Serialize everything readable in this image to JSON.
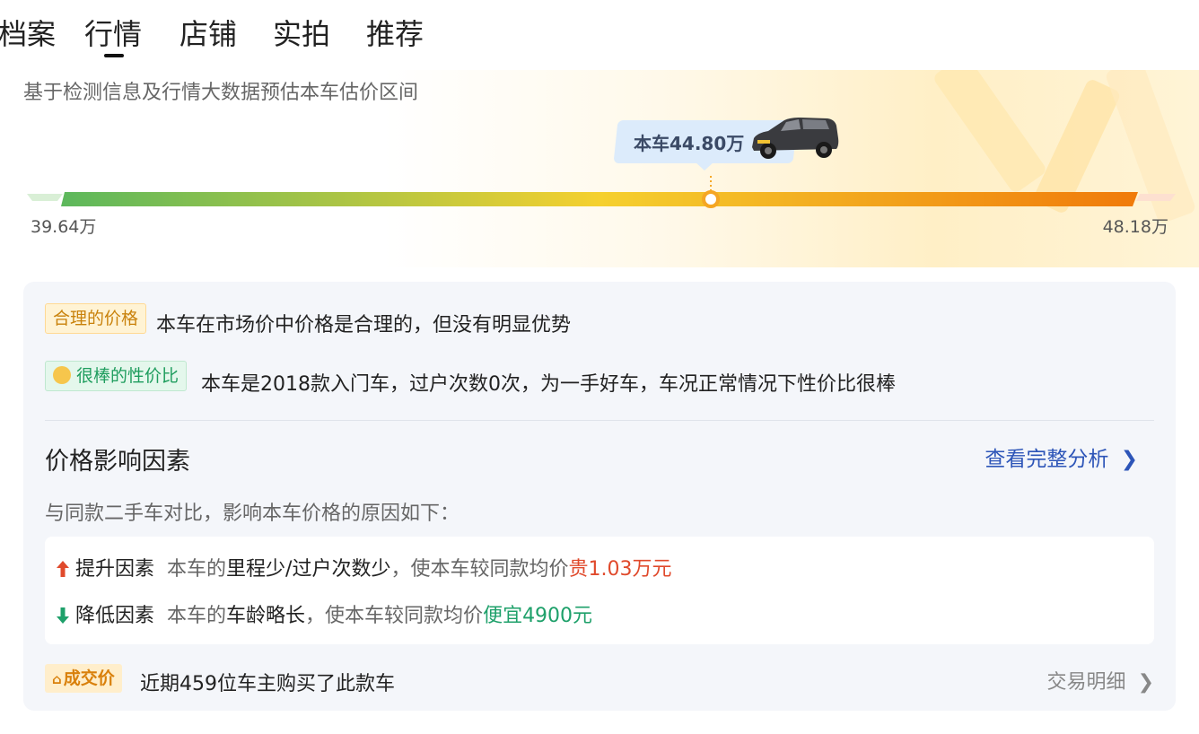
{
  "tabs": [
    "档案",
    "行情",
    "店铺",
    "实拍",
    "推荐"
  ],
  "active_tab": "行情",
  "estimate": {
    "subtitle": "基于检测信息及行情大数据预估本车估价区间",
    "current_price_label": "本车44.80万",
    "min_label": "39.64万",
    "max_label": "48.18万",
    "min_value": 39.64,
    "max_value": 48.18,
    "current_value": 44.8,
    "colors": {
      "green": "#5cb85c",
      "yellow": "#f5d02f",
      "orange": "#f07a0a"
    }
  },
  "assessment": {
    "reasonable_tag": "合理的价格",
    "reasonable_text": "本车在市场价中价格是合理的，但没有明显优势",
    "value_tag": "很棒的性价比",
    "value_text": "本车是2018款入门车，过户次数0次，为一手好车，车况正常情况下性价比很棒"
  },
  "factors": {
    "title": "价格影响因素",
    "link_label": "查看完整分析",
    "description": "与同款二手车对比，影响本车价格的原因如下：",
    "up": {
      "label": "提升因素",
      "prefix": "本车的",
      "highlight": "里程少/过户次数少",
      "middle": "，使本车较同款均价",
      "amount": "贵1.03万元"
    },
    "down": {
      "label": "降低因素",
      "prefix": "本车的",
      "highlight": "车龄略长",
      "middle": "，使本车较同款均价",
      "amount": "便宜4900元"
    }
  },
  "deal": {
    "tag": "成交价",
    "text": "近期459位车主购买了此款车",
    "link_label": "交易明细"
  }
}
